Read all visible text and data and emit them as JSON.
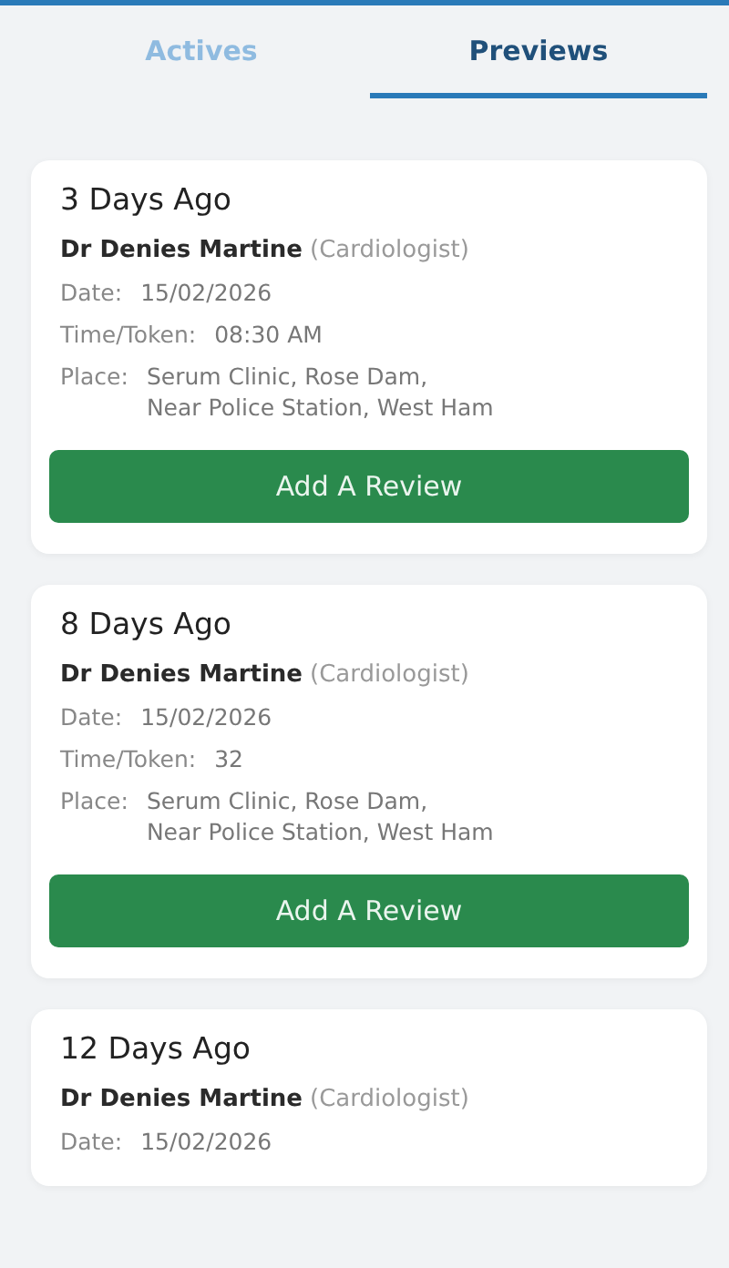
{
  "tabs": [
    {
      "label": "Actives",
      "selected": false
    },
    {
      "label": "Previews",
      "selected": true
    }
  ],
  "cards": [
    {
      "title": "3 Days Ago",
      "doctor": "Dr Denies Martine",
      "specialty": "(Cardiologist)",
      "rows": [
        {
          "label": "Date:",
          "lines": [
            "15/02/2026"
          ]
        },
        {
          "label": "Time/Token:",
          "lines": [
            "08:30 AM"
          ]
        },
        {
          "label": "Place:",
          "lines": [
            "Serum Clinic, Rose Dam,",
            "Near Police Station, West Ham"
          ]
        }
      ],
      "button": "Add A Review"
    },
    {
      "title": "8 Days Ago",
      "doctor": "Dr Denies Martine",
      "specialty": "(Cardiologist)",
      "rows": [
        {
          "label": "Date:",
          "lines": [
            "15/02/2026"
          ]
        },
        {
          "label": "Time/Token:",
          "lines": [
            "32"
          ]
        },
        {
          "label": "Place:",
          "lines": [
            "Serum Clinic, Rose Dam,",
            "Near Police Station, West Ham"
          ]
        }
      ],
      "button": "Add A Review"
    },
    {
      "title": "12 Days Ago",
      "doctor": "Dr Denies Martine",
      "specialty": "(Cardiologist)",
      "rows": [
        {
          "label": "Date:",
          "lines": [
            "15/02/2026"
          ]
        }
      ]
    }
  ]
}
